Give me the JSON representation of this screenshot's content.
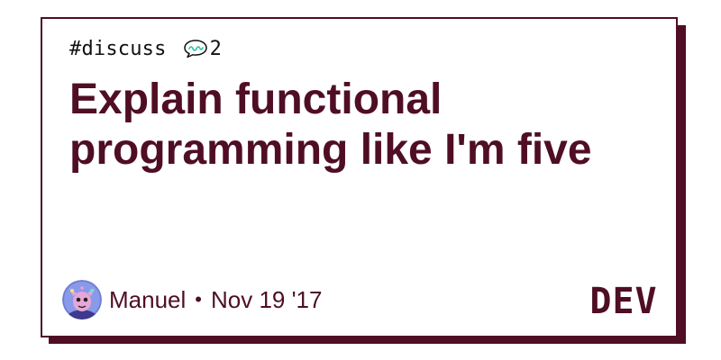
{
  "post": {
    "tag": "#discuss",
    "comment_count": "2",
    "title": "Explain functional programming like I'm five",
    "author": "Manuel",
    "separator": "•",
    "date": "Nov 19 '17"
  },
  "brand": {
    "logo_text": "DEV",
    "color": "#4f0e25"
  },
  "icons": {
    "comments": "comment-bubble-icon",
    "avatar": "avatar-image"
  }
}
